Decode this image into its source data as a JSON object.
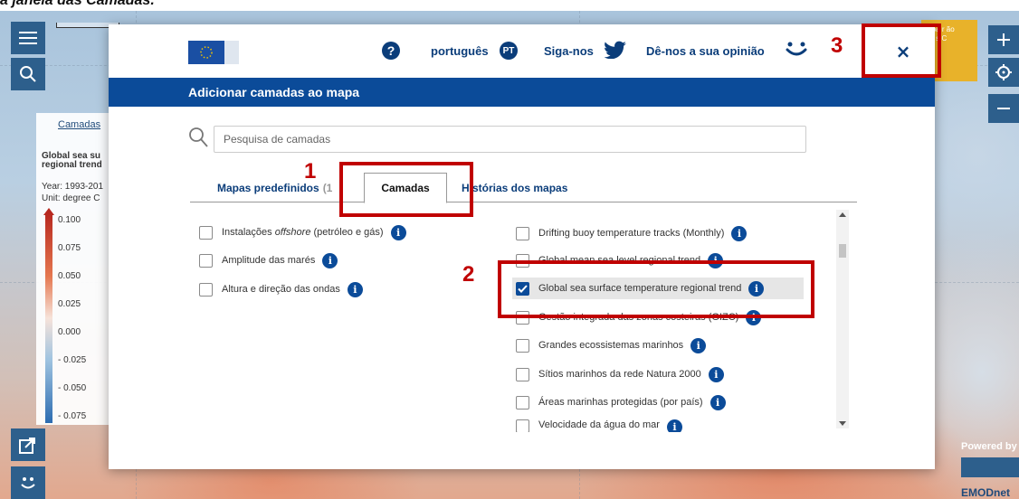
{
  "caption": "a janela das Camadas.",
  "map": {
    "legend_link": "Camadas",
    "legend_title": "Global sea su regional trend",
    "legend_year": "Year: 1993-201",
    "legend_unit": "Unit: degree C",
    "legend_ticks": [
      "0.100",
      "0.075",
      "0.050",
      "0.025",
      "0.000",
      "- 0.025",
      "- 0.050",
      "- 0.075"
    ],
    "info_box_text": "n mapa r ão sobre s C",
    "powered_by": "Powered by",
    "brand": "EMODnet",
    "colors": {
      "panel_blue": "#2d5f8c",
      "info_yellow": "#e8b22a"
    }
  },
  "modal": {
    "header": {
      "logo": "eu-flag-logo",
      "help_icon": "question-circle-icon",
      "language_label": "português",
      "language_code": "PT",
      "follow_label": "Siga-nos",
      "feedback_label": "Dê-nos a sua opinião",
      "close_label": "×"
    },
    "title": "Adicionar camadas ao mapa",
    "search": {
      "placeholder": "Pesquisa de camadas",
      "value": ""
    },
    "tabs": [
      {
        "label": "Mapas predefinidos",
        "count": "(1",
        "active": false
      },
      {
        "label": "Camadas",
        "active": true
      },
      {
        "label": "Histórias dos mapas",
        "active": false
      }
    ],
    "left_list": [
      {
        "label_pre": "Instalações ",
        "label_em": "offshore",
        "label_post": " (petróleo e gás)",
        "checked": false
      },
      {
        "label_pre": "Amplitude das marés",
        "label_em": "",
        "label_post": "",
        "checked": false
      },
      {
        "label_pre": "Altura e direção das ondas",
        "label_em": "",
        "label_post": "",
        "checked": false
      }
    ],
    "right_list": [
      {
        "label": "Drifting buoy temperature tracks (Monthly)",
        "checked": false
      },
      {
        "label": "Global mean sea level regional trend",
        "checked": false
      },
      {
        "label": "Global sea surface temperature regional trend",
        "checked": true
      },
      {
        "label": "Gestão integrada das zonas costeiras (GIZC)",
        "checked": false
      },
      {
        "label": "Grandes ecossistemas marinhos",
        "checked": false
      },
      {
        "label": "Sítios marinhos da rede Natura 2000",
        "checked": false
      },
      {
        "label": "Áreas marinhas protegidas (por país)",
        "checked": false
      },
      {
        "label": "Velocidade da água do mar",
        "checked": false
      }
    ],
    "colors": {
      "header_bar": "#0b4b99",
      "link_text": "#0b3d7a"
    }
  },
  "callouts": [
    {
      "number": "1",
      "target": "tab-layers"
    },
    {
      "number": "2",
      "target": "global-sst-item"
    },
    {
      "number": "3",
      "target": "close-button"
    }
  ],
  "callout_color": "#c00000"
}
